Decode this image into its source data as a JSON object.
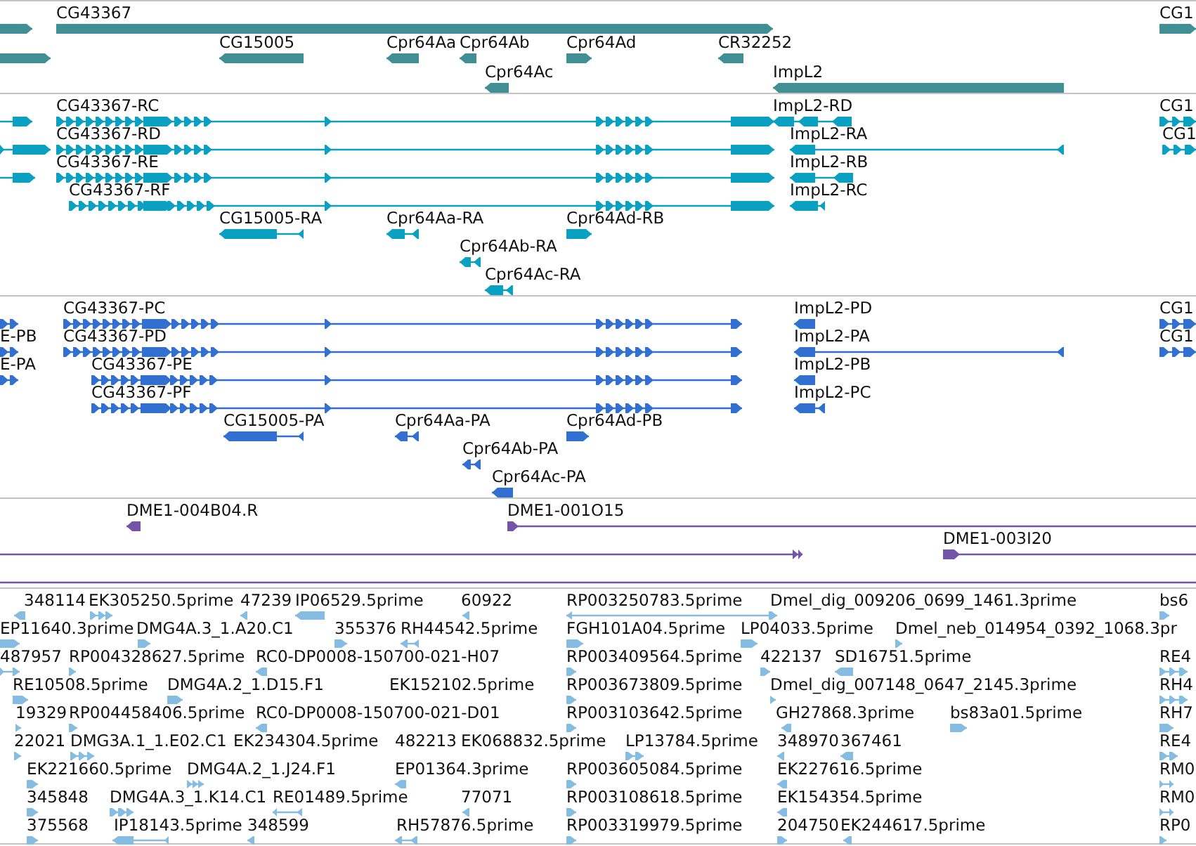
{
  "tracks": [
    {
      "kind": "genes",
      "features": [
        {
          "reverse": false
        },
        {
          "label": "CG43367",
          "reverse": false
        },
        {
          "label": "CG1",
          "reverse": false
        },
        {
          "reverse": false
        },
        {
          "label": "CG15005",
          "reverse": true
        },
        {
          "label": "Cpr64Aa",
          "reverse": true
        },
        {
          "label": "Cpr64Ab",
          "reverse": true
        },
        {
          "label": "Cpr64Ad",
          "reverse": false
        },
        {
          "label": "CR32252",
          "reverse": true
        },
        {
          "label": "Cpr64Ac",
          "reverse": true
        },
        {
          "label": "ImpL2",
          "reverse": true
        }
      ]
    },
    {
      "kind": "transcripts",
      "features": [
        {
          "reverse": false
        },
        {
          "label": "CG43367-RC",
          "reverse": false
        },
        {
          "label": "ImpL2-RD",
          "reverse": true
        },
        {
          "label": "CG1",
          "reverse": false
        },
        {
          "reverse": false
        },
        {
          "label": "CG43367-RD",
          "reverse": false
        },
        {
          "label": "ImpL2-RA",
          "reverse": true
        },
        {
          "label": "CG1",
          "reverse": false
        },
        {
          "reverse": false
        },
        {
          "label": "CG43367-RE",
          "reverse": false
        },
        {
          "label": "ImpL2-RB",
          "reverse": true
        },
        {
          "label": "CG43367-RF",
          "reverse": false
        },
        {
          "label": "ImpL2-RC",
          "reverse": true
        },
        {
          "label": "CG15005-RA",
          "reverse": true
        },
        {
          "label": "Cpr64Aa-RA",
          "reverse": true
        },
        {
          "label": "Cpr64Ad-RB",
          "reverse": false
        },
        {
          "label": "Cpr64Ab-RA",
          "reverse": true
        },
        {
          "label": "Cpr64Ac-RA",
          "reverse": true
        }
      ]
    },
    {
      "kind": "proteins",
      "features": [
        {
          "reverse": false
        },
        {
          "label": "CG43367-PC",
          "reverse": false
        },
        {
          "label": "ImpL2-PD",
          "reverse": true
        },
        {
          "label": "CG1",
          "reverse": false
        },
        {
          "label": "E-PB",
          "reverse": false
        },
        {
          "label": "CG43367-PD",
          "reverse": false
        },
        {
          "label": "ImpL2-PA",
          "reverse": true
        },
        {
          "label": "CG1",
          "reverse": false
        },
        {
          "label": "E-PA",
          "reverse": false
        },
        {
          "label": "CG43367-PE",
          "reverse": false
        },
        {
          "label": "ImpL2-PB",
          "reverse": true
        },
        {
          "label": "CG43367-PF",
          "reverse": false
        },
        {
          "label": "ImpL2-PC",
          "reverse": true
        },
        {
          "label": "CG15005-PA",
          "reverse": true
        },
        {
          "label": "Cpr64Aa-PA",
          "reverse": true
        },
        {
          "label": "Cpr64Ad-PB",
          "reverse": false
        },
        {
          "label": "Cpr64Ab-PA",
          "reverse": true
        },
        {
          "label": "Cpr64Ac-PA",
          "reverse": true
        }
      ]
    },
    {
      "kind": "clones",
      "features": [
        {
          "label": "DME1-004B04.R",
          "reverse": true
        },
        {
          "label": "DME1-001O15",
          "reverse": false
        },
        {
          "reverse": false
        },
        {
          "label": "DME1-003I20",
          "reverse": false
        },
        {
          "kind": "line"
        }
      ]
    },
    {
      "kind": "ests",
      "features": [
        {
          "label": "348114",
          "reverse": true
        },
        {
          "label": "EK305250.5prime",
          "reverse": false
        },
        {
          "label": "47239",
          "reverse": true
        },
        {
          "label": "IP06529.5prime",
          "reverse": true
        },
        {
          "label": "60922",
          "reverse": true
        },
        {
          "label": "RP003250783.5prime",
          "reverse": true
        },
        {
          "label": "Dmel_dig_009206_0699_1461.3prime",
          "reverse": false
        },
        {
          "label": "bs6",
          "reverse": false
        },
        {
          "label": "EP11640.3prime",
          "reverse": false
        },
        {
          "label": "DMG4A.3_1.A20.C1",
          "reverse": false
        },
        {
          "label": "355376",
          "reverse": false
        },
        {
          "label": "RH44542.5prime",
          "reverse": true
        },
        {
          "label": "FGH101A04.5prime",
          "reverse": false
        },
        {
          "label": "LP04033.5prime",
          "reverse": false
        },
        {
          "label": "Dmel_neb_014954_0392_1068.3pr",
          "reverse": false
        },
        {
          "label": "487957",
          "reverse": false
        },
        {
          "label": "RP004328627.5prime",
          "reverse": false
        },
        {
          "label": "RC0-DP0008-150700-021-H07",
          "reverse": true
        },
        {
          "label": "RP003409564.5prime",
          "reverse": false
        },
        {
          "label": "422137",
          "reverse": false
        },
        {
          "label": "SD16751.5prime",
          "reverse": true
        },
        {
          "label": "RE4",
          "reverse": false
        },
        {
          "label": "RE10508.5prime",
          "reverse": false
        },
        {
          "label": "DMG4A.2_1.D15.F1",
          "reverse": false
        },
        {
          "label": "EK152102.5prime"
        },
        {
          "label": "RP003673809.5prime",
          "reverse": false
        },
        {
          "label": "Dmel_dig_007148_0647_2145.3prime",
          "reverse": false
        },
        {
          "label": "RH4",
          "reverse": false
        },
        {
          "label": "19329",
          "reverse": false
        },
        {
          "label": "RP004458406.5prime",
          "reverse": false
        },
        {
          "label": "RC0-DP0008-150700-021-D01",
          "reverse": true
        },
        {
          "label": "RP003103642.5prime",
          "reverse": false
        },
        {
          "label": "GH27868.3prime",
          "reverse": true
        },
        {
          "label": "bs83a01.5prime",
          "reverse": false
        },
        {
          "label": "RH7",
          "reverse": false
        },
        {
          "label": "22021",
          "reverse": false
        },
        {
          "label": "DMG3A.1_1.E02.C1",
          "reverse": false
        },
        {
          "label": "EK234304.5prime"
        },
        {
          "label": "482213"
        },
        {
          "label": "EK068832.5prime"
        },
        {
          "label": "LP13784.5prime",
          "reverse": false
        },
        {
          "label": "348970",
          "reverse": true
        },
        {
          "label": "367461",
          "reverse": true
        },
        {
          "label": "RE4",
          "reverse": false
        },
        {
          "label": "EK221660.5prime",
          "reverse": false
        },
        {
          "label": "DMG4A.2_1.J24.F1",
          "reverse": false
        },
        {
          "label": "EP01364.3prime",
          "reverse": true
        },
        {
          "label": "RP003605084.5prime",
          "reverse": false
        },
        {
          "label": "EK227616.5prime",
          "reverse": true
        },
        {
          "label": "RM0",
          "reverse": false
        },
        {
          "label": "345848",
          "reverse": false
        },
        {
          "label": "DMG4A.3_1.K14.C1",
          "reverse": false
        },
        {
          "label": "RE01489.5prime",
          "reverse": true
        },
        {
          "label": "77071",
          "reverse": true
        },
        {
          "label": "RP003108618.5prime",
          "reverse": false
        },
        {
          "label": "EK154354.5prime",
          "reverse": true
        },
        {
          "label": "RM0",
          "reverse": false
        },
        {
          "label": "375568",
          "reverse": false
        },
        {
          "label": "IP18143.5prime",
          "reverse": true
        },
        {
          "label": "348599",
          "reverse": true
        },
        {
          "label": "RH57876.5prime",
          "reverse": true
        },
        {
          "label": "RP003319979.5prime",
          "reverse": false
        },
        {
          "label": "204750",
          "reverse": false
        },
        {
          "label": "EK244617.5prime",
          "reverse": true
        },
        {
          "label": "RP0",
          "reverse": false
        }
      ]
    }
  ]
}
